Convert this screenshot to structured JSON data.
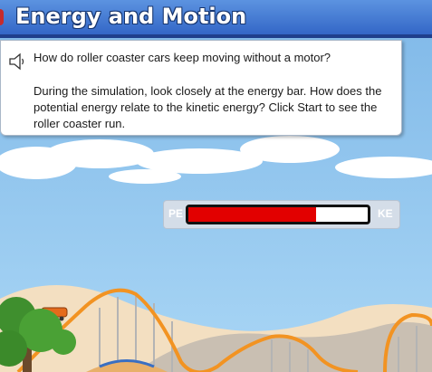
{
  "header": {
    "title": "Energy and Motion"
  },
  "question": {
    "main": "How do roller coaster cars keep moving without a motor?",
    "instructions": "During the simulation, look closely at the energy bar. How does the potential energy relate to the kinetic energy? Click Start to see the roller coaster run."
  },
  "energy_bar": {
    "pe_label": "PE",
    "ke_label": "KE",
    "potential_energy_fraction": 0.71,
    "pe_color": "#e20000"
  },
  "icons": {
    "speaker": "speaker-icon"
  }
}
